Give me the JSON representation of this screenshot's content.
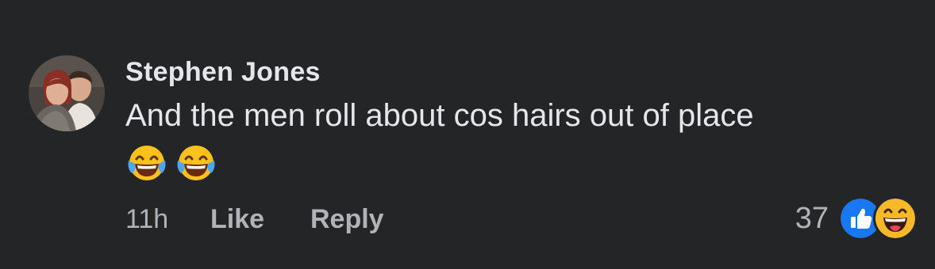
{
  "comment": {
    "author": "Stephen Jones",
    "text": "And the men roll about cos hairs out of place",
    "emojis": [
      "face-with-tears-of-joy-icon",
      "face-with-tears-of-joy-icon"
    ],
    "timestamp": "11h",
    "like_label": "Like",
    "reply_label": "Reply",
    "reaction_count": "37",
    "reaction_icons": [
      "like-reaction-icon",
      "haha-reaction-icon"
    ]
  },
  "colors": {
    "background": "#242526",
    "primary_text": "#e4e6eb",
    "secondary_text": "#b0b3b8",
    "like_blue": "#1877f2",
    "haha_yellow": "#f7b928"
  }
}
